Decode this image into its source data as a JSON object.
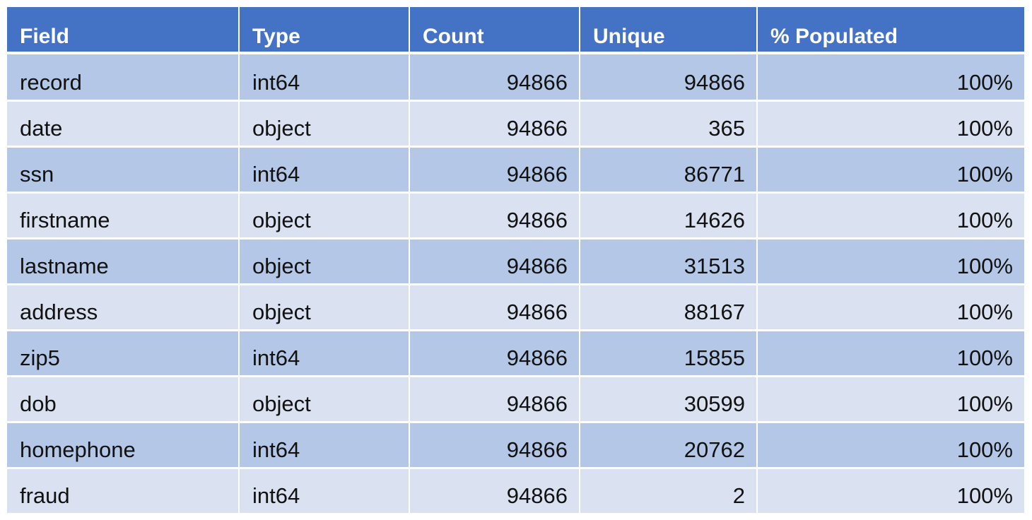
{
  "table": {
    "headers": [
      "Field",
      "Type",
      "Count",
      "Unique",
      "% Populated"
    ],
    "rows": [
      [
        "record",
        "int64",
        "94866",
        "94866",
        "100%"
      ],
      [
        "date",
        "object",
        "94866",
        "365",
        "100%"
      ],
      [
        "ssn",
        "int64",
        "94866",
        "86771",
        "100%"
      ],
      [
        "firstname",
        "object",
        "94866",
        "14626",
        "100%"
      ],
      [
        "lastname",
        "object",
        "94866",
        "31513",
        "100%"
      ],
      [
        "address",
        "object",
        "94866",
        "88167",
        "100%"
      ],
      [
        "zip5",
        "int64",
        "94866",
        "15855",
        "100%"
      ],
      [
        "dob",
        "object",
        "94866",
        "30599",
        "100%"
      ],
      [
        "homephone",
        "int64",
        "94866",
        "20762",
        "100%"
      ],
      [
        "fraud",
        "int64",
        "94866",
        "2",
        "100%"
      ]
    ]
  },
  "colors": {
    "header_bg": "#4472c4",
    "row_dark": "#b4c7e7",
    "row_light": "#dae1f1"
  }
}
